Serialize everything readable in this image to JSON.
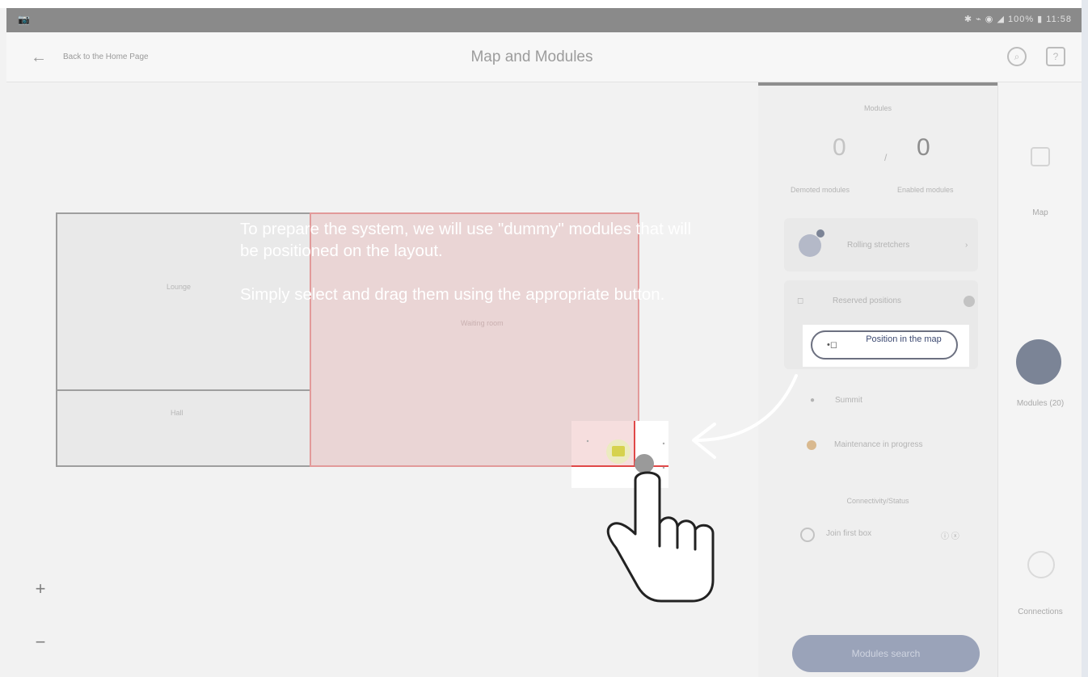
{
  "status_bar": {
    "left": "📷",
    "right": "✱ ⌁ ◉ ◢ 100% ▮ 11:58"
  },
  "header": {
    "back_label": "Back to the Home Page",
    "title": "Map and Modules",
    "icons": [
      "search-icon",
      "help-icon"
    ]
  },
  "map": {
    "rooms": [
      "Lounge",
      "Hall"
    ],
    "zone_label": "Waiting room",
    "zoom_in": "+",
    "zoom_out": "−"
  },
  "panel": {
    "section_title": "Modules",
    "counter_left": "0",
    "counter_separator": "/",
    "counter_right": "0",
    "label_left": "Demoted modules",
    "label_right": "Enabled modules",
    "folding_label": "Rolling stretchers",
    "reserved_label": "Reserved positions",
    "position_button": "Position in the map",
    "rows": [
      "Summit",
      "Maintenance in progress"
    ],
    "box_section_title": "Connectivity/Status",
    "box_row_label": "Join first box",
    "search_button": "Modules search"
  },
  "sidebar": {
    "items": [
      "Map",
      "Modules (20)",
      "Connections"
    ]
  },
  "tutorial": {
    "paragraph_1": "To prepare the system, we will use \"dummy\" modules that will be positioned on the layout.",
    "paragraph_2": "Simply select and drag them using the appropriate button."
  },
  "colors": {
    "overlay": "#828282",
    "zone_border": "#e07575",
    "accent_button": "#3d4a72"
  }
}
